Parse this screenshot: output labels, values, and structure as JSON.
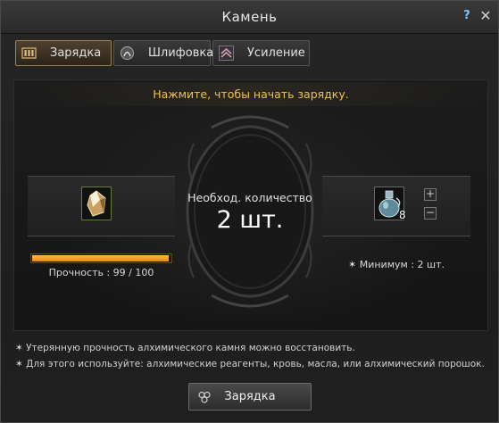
{
  "window": {
    "title": "Камень",
    "help_label": "?",
    "close_label": "✕"
  },
  "tabs": [
    {
      "label": "Зарядка",
      "icon": "charge-icon",
      "active": true
    },
    {
      "label": "Шлифовка",
      "icon": "polish-icon",
      "active": false
    },
    {
      "label": "Усиление",
      "icon": "enhance-icon",
      "active": false
    }
  ],
  "hint": "Нажмите, чтобы начать зарядку.",
  "stone": {
    "icon": "alchemy-stone-icon",
    "durability_label": "Прочность : 99 / 100",
    "durability_fraction": 0.99
  },
  "required": {
    "label": "Необход. количество",
    "value": "2 шт."
  },
  "reagent": {
    "icon": "reagent-flask-icon",
    "quantity": "8",
    "plus_label": "+",
    "minus_label": "−",
    "minimum_label": "✶ Минимум : 2 шт."
  },
  "notes": [
    "✶ Утерянную прочность алхимического камня можно восстановить.",
    "✶ Для этого используйте: алхимические реагенты, кровь, масла, или алхимический порошок."
  ],
  "action": {
    "label": "Зарядка",
    "icon": "triskelion-icon"
  },
  "colors": {
    "accent_gold": "#f0c24c",
    "durability_bar": "#f0a030",
    "active_tab_border": "#a08050"
  }
}
